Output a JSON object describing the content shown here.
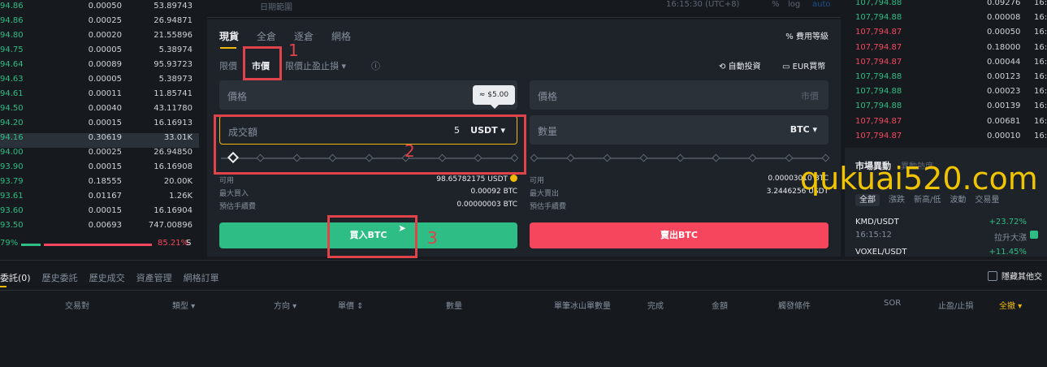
{
  "order_book": {
    "rows": [
      {
        "price": "94.86",
        "amount": "0.00050",
        "total": "53.89743"
      },
      {
        "price": "94.86",
        "amount": "0.00025",
        "total": "26.94871"
      },
      {
        "price": "94.80",
        "amount": "0.00020",
        "total": "21.55896"
      },
      {
        "price": "94.75",
        "amount": "0.00005",
        "total": "5.38974"
      },
      {
        "price": "94.64",
        "amount": "0.00089",
        "total": "95.93723"
      },
      {
        "price": "94.63",
        "amount": "0.00005",
        "total": "5.38973"
      },
      {
        "price": "94.61",
        "amount": "0.00011",
        "total": "11.85741"
      },
      {
        "price": "94.50",
        "amount": "0.00040",
        "total": "43.11780"
      },
      {
        "price": "94.20",
        "amount": "0.00015",
        "total": "16.16913"
      },
      {
        "price": "94.16",
        "amount": "0.30619",
        "total": "33.01K"
      },
      {
        "price": "94.00",
        "amount": "0.00025",
        "total": "26.94850"
      },
      {
        "price": "93.90",
        "amount": "0.00015",
        "total": "16.16908"
      },
      {
        "price": "93.79",
        "amount": "0.18555",
        "total": "20.00K"
      },
      {
        "price": "93.61",
        "amount": "0.01167",
        "total": "1.26K"
      },
      {
        "price": "93.60",
        "amount": "0.00015",
        "total": "16.16904"
      },
      {
        "price": "93.50",
        "amount": "0.00693",
        "total": "747.00896"
      }
    ],
    "buy_ratio": "79%",
    "sell_ratio": "85.21%",
    "sell_mark": "S"
  },
  "chart_toolbar": {
    "range": "日期範圍",
    "time": "16:15:30 (UTC+8)",
    "pct": "%",
    "log": "log",
    "auto": "auto"
  },
  "trade_panel": {
    "tabs": [
      "現貨",
      "全倉",
      "逐倉",
      "網格"
    ],
    "fee_label": "費用等級",
    "order_types": [
      "限價",
      "市價",
      "限價止盈止損 ▾"
    ],
    "auto_invest": "自動投資",
    "eur_buy": "EUR買幣",
    "buy_side": {
      "price_label": "價格",
      "amount_label": "成交額",
      "amount_value": "5",
      "amount_unit": "USDT ▾",
      "tooltip": "≈ $5.00",
      "available_label": "可用",
      "available_value": "98.65782175 USDT",
      "max_label": "最大買入",
      "max_value": "0.00092 BTC",
      "fee_label": "預估手續費",
      "fee_value": "0.00000003 BTC",
      "button": "買入BTC"
    },
    "sell_side": {
      "price_label": "價格",
      "price_right": "市價",
      "qty_label": "數量",
      "qty_unit": "BTC ▾",
      "available_label": "可用",
      "available_value": "0.00003010 BTC",
      "max_label": "最大賣出",
      "max_value": "3.2446256 USDT",
      "fee_label": "預估手續費",
      "button": "賣出BTC"
    }
  },
  "annotations": [
    "1",
    "2",
    "3"
  ],
  "recent_trades": {
    "rows": [
      {
        "price": "107,794.88",
        "amount": "0.09276",
        "time": "16:",
        "side": "buy"
      },
      {
        "price": "107,794.88",
        "amount": "0.00008",
        "time": "16:",
        "side": "buy"
      },
      {
        "price": "107,794.87",
        "amount": "0.00050",
        "time": "16:",
        "side": "sell"
      },
      {
        "price": "107,794.87",
        "amount": "0.18000",
        "time": "16:",
        "side": "sell"
      },
      {
        "price": "107,794.87",
        "amount": "0.00044",
        "time": "16:",
        "side": "sell"
      },
      {
        "price": "107,794.88",
        "amount": "0.00123",
        "time": "16:",
        "side": "buy"
      },
      {
        "price": "107,794.88",
        "amount": "0.00023",
        "time": "16:",
        "side": "buy"
      },
      {
        "price": "107,794.88",
        "amount": "0.00139",
        "time": "16:",
        "side": "buy"
      },
      {
        "price": "107,794.87",
        "amount": "0.00681",
        "time": "16:",
        "side": "sell"
      },
      {
        "price": "107,794.87",
        "amount": "0.00010",
        "time": "16:",
        "side": "sell"
      }
    ],
    "buy_color": "#2ebd85",
    "sell_color": "#f6465d"
  },
  "market_movers": {
    "title": "市場異動",
    "title2": "異動熱度",
    "tabs": [
      "全部",
      "漲跌",
      "新高/低",
      "波動",
      "交易量"
    ],
    "items": [
      {
        "pair": "KMD/USDT",
        "change": "+23.72%",
        "time": "16:15:12",
        "desc": "拉升大漲"
      },
      {
        "pair": "VOXEL/USDT",
        "change": "+11.45%"
      }
    ]
  },
  "watermark": "qukuai520.com",
  "orders": {
    "tabs": [
      "委託(0)",
      "歷史委託",
      "歷史成交",
      "資產管理",
      "網格訂單"
    ],
    "hide_other": "隱藏其他交",
    "columns": [
      "交易對",
      "類型 ▾",
      "方向 ▾",
      "單價 ⇕",
      "數量",
      "單筆冰山單數量",
      "完成",
      "金額",
      "觸發條件",
      "SOR",
      "止盈/止損",
      "全撤 ▾"
    ]
  }
}
